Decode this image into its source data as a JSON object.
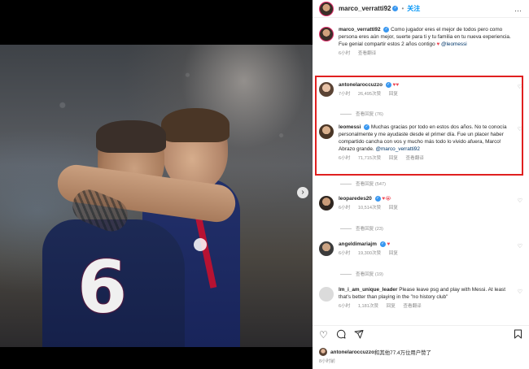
{
  "post": {
    "jersey_number": "6",
    "next_icon": "chevron-right-icon"
  },
  "header": {
    "username": "marco_verratti92",
    "separator": "•",
    "follow_label": "关注",
    "more": "…"
  },
  "caption": {
    "username": "marco_verratti92",
    "text": "Como jugador eres el mejor de todos pero como persona eres aún mejor, suerte para ti y tu familia en tu nueva experiencia. Fue genial compartir estos 2 años contigo",
    "emoji": "♥",
    "mention": "@leomessi",
    "time": "6小时",
    "translate": "查看翻译"
  },
  "comments": [
    {
      "username": "antonelaroccuzzo",
      "text": "",
      "emoji": "♥♥",
      "time": "7小时",
      "likes": "26,495次赞",
      "reply": "回复",
      "replies": "查看回复 (76)"
    },
    {
      "username": "leomessi",
      "text": "Muchas gracias por todo en estos dos años. No te conocía personalmente y me ayudaste desde el primer día. Fue un placer haber compartido cancha con vos y mucho más todo lo vivido afuera, Marco! Abrazo grande.",
      "mention": "@marco_verratti92",
      "time": "6小时",
      "likes": "71,715次赞",
      "reply": "回复",
      "translate": "查看翻译",
      "replies": "查看回复 (547)"
    },
    {
      "username": "leoparedes20",
      "text": "",
      "emoji": "♥😭",
      "time": "6小时",
      "likes": "10,514次赞",
      "reply": "回复",
      "replies": "查看回复 (23)"
    },
    {
      "username": "angeldimariajm",
      "text": "",
      "emoji": "♥",
      "time": "6小时",
      "likes": "19,300次赞",
      "reply": "回复",
      "replies": "查看回复 (19)"
    },
    {
      "username": "lm_i_am_unique_leader",
      "text": "Please leave psg and play with Messi. At least that's better than playing in the \"no history club\"",
      "time": "6小时",
      "likes": "1,181次赞",
      "reply": "回复",
      "translate": "查看翻译"
    }
  ],
  "actions": {
    "like_icon": "heart-icon",
    "comment_icon": "comment-icon",
    "share_icon": "share-icon",
    "save_icon": "bookmark-icon"
  },
  "likes_line": {
    "username": "antonelaroccuzzo",
    "text": "和其他77.4万位用户赞了"
  },
  "post_time": "8小时前"
}
